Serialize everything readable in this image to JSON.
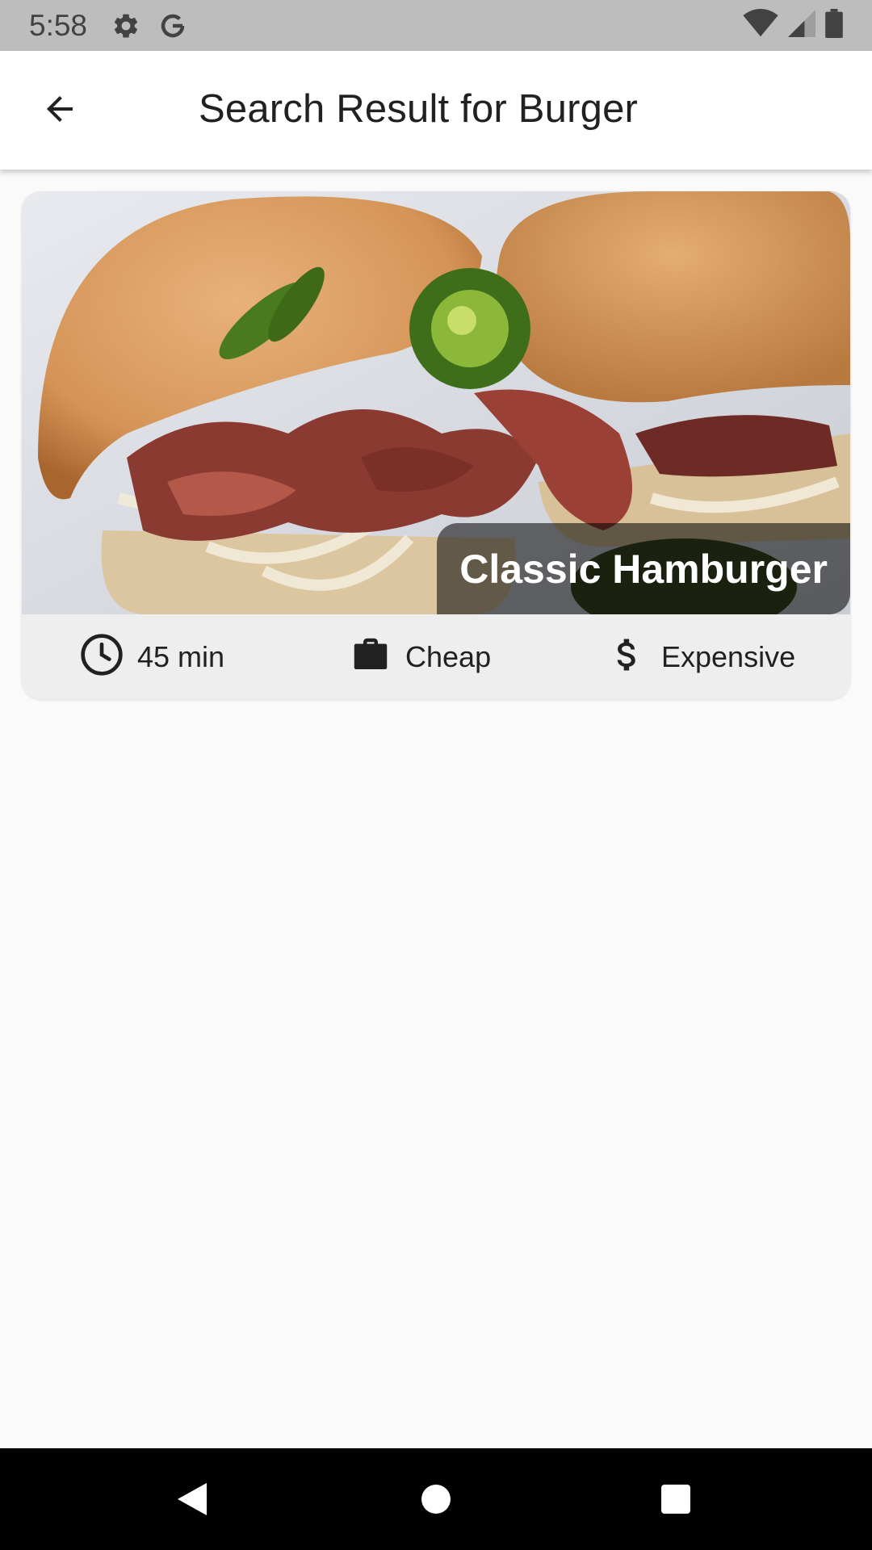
{
  "status_bar": {
    "time": "5:58",
    "left_icons": [
      "gear-icon",
      "google-g-icon"
    ],
    "right_icons": [
      "wifi-icon",
      "signal-icon",
      "battery-icon"
    ],
    "color": "#bdbdbd"
  },
  "app_bar": {
    "title": "Search Result for Burger",
    "back_icon": "arrow-back-icon"
  },
  "results": [
    {
      "title": "Classic Hamburger",
      "image": "burger-photo",
      "duration": "45 min",
      "affordability": "Cheap",
      "complexity": "Expensive",
      "icons": {
        "duration": "clock-icon",
        "affordability": "briefcase-icon",
        "complexity": "dollar-icon"
      }
    }
  ],
  "nav_bar": {
    "icons": [
      "nav-back-icon",
      "nav-home-icon",
      "nav-recents-icon"
    ]
  }
}
